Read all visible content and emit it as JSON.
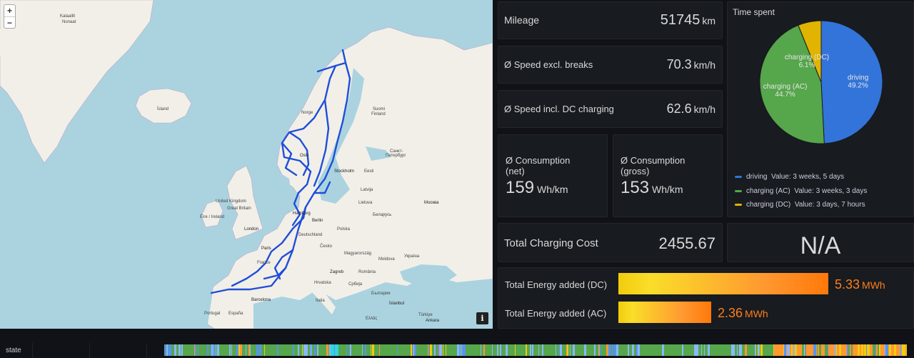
{
  "map": {
    "zoom_in": "+",
    "zoom_out": "−",
    "info": "i",
    "labels": [
      {
        "text": "Kalaallit",
        "cls": ""
      },
      {
        "text": "Nunaat",
        "cls": ""
      },
      {
        "text": "Ísland",
        "cls": ""
      },
      {
        "text": "Norge",
        "cls": ""
      },
      {
        "text": "Suomi",
        "cls": ""
      },
      {
        "text": "Finland",
        "cls": ""
      },
      {
        "text": "Санкт-",
        "cls": ""
      },
      {
        "text": "Петербург",
        "cls": ""
      },
      {
        "text": "Oslo",
        "cls": "city"
      },
      {
        "text": "Stockholm",
        "cls": "city"
      },
      {
        "text": "Eesti",
        "cls": ""
      },
      {
        "text": "Latvija",
        "cls": ""
      },
      {
        "text": "Lietuva",
        "cls": ""
      },
      {
        "text": "Москва",
        "cls": "city"
      },
      {
        "text": "Беларусь",
        "cls": ""
      },
      {
        "text": "United Kingdom",
        "cls": ""
      },
      {
        "text": "Great Britain",
        "cls": ""
      },
      {
        "text": "Éire / Ireland",
        "cls": ""
      },
      {
        "text": "London",
        "cls": "city"
      },
      {
        "text": "Hamburg",
        "cls": "city"
      },
      {
        "text": "Berlin",
        "cls": "city"
      },
      {
        "text": "Polska",
        "cls": ""
      },
      {
        "text": "Deutschland",
        "cls": ""
      },
      {
        "text": "Česko",
        "cls": ""
      },
      {
        "text": "Paris",
        "cls": "city"
      },
      {
        "text": "France",
        "cls": ""
      },
      {
        "text": "Україна",
        "cls": ""
      },
      {
        "text": "Moldova",
        "cls": ""
      },
      {
        "text": "Magyarország",
        "cls": ""
      },
      {
        "text": "Zagreb",
        "cls": "city"
      },
      {
        "text": "România",
        "cls": ""
      },
      {
        "text": "Hrvatska",
        "cls": ""
      },
      {
        "text": "Србија",
        "cls": ""
      },
      {
        "text": "България",
        "cls": ""
      },
      {
        "text": "Barcelona",
        "cls": "city"
      },
      {
        "text": "Portugal",
        "cls": ""
      },
      {
        "text": "España",
        "cls": ""
      },
      {
        "text": "Italia",
        "cls": ""
      },
      {
        "text": "Ελλάς",
        "cls": ""
      },
      {
        "text": "Türkiye",
        "cls": ""
      },
      {
        "text": "İstanbul",
        "cls": "city"
      },
      {
        "text": "Ankara",
        "cls": "city"
      }
    ]
  },
  "mileage": {
    "title": "Mileage",
    "value": "51745",
    "unit": "km"
  },
  "speed_excl": {
    "title": "Ø Speed excl. breaks",
    "value": "70.3",
    "unit": "km/h"
  },
  "speed_incl": {
    "title": "Ø Speed incl. DC charging",
    "value": "62.6",
    "unit": "km/h"
  },
  "cons_net": {
    "title_line1": "Ø Consumption",
    "title_line2": "(net)",
    "value": "159",
    "unit": "Wh/km"
  },
  "cons_gross": {
    "title_line1": "Ø Consumption",
    "title_line2": "(gross)",
    "value": "153",
    "unit": "Wh/km"
  },
  "charging_cost": {
    "title": "Total Charging Cost",
    "value": "2455.67"
  },
  "na_panel": {
    "value": "N/A"
  },
  "energy": {
    "dc": {
      "label": "Total Energy added (DC)",
      "value": "5.33",
      "unit": "MWh",
      "fraction": 1.0
    },
    "ac": {
      "label": "Total Energy added (AC)",
      "value": "2.36",
      "unit": "MWh",
      "fraction": 0.443
    }
  },
  "time_spent": {
    "title": "Time spent",
    "legend": [
      {
        "name": "driving",
        "value_text": "Value: 3 weeks, 5 days",
        "color": "#3274d9"
      },
      {
        "name": "charging (AC)",
        "value_text": "Value: 3 weeks, 3 days",
        "color": "#56a64b"
      },
      {
        "name": "charging (DC)",
        "value_text": "Value: 3 days, 7 hours",
        "color": "#e0b400"
      }
    ]
  },
  "chart_data": {
    "type": "pie",
    "title": "Time spent",
    "slices": [
      {
        "label": "driving",
        "percent": 49.2,
        "percent_text": "49.2%",
        "color": "#3274d9"
      },
      {
        "label": "charging (AC)",
        "percent": 44.7,
        "percent_text": "44.7%",
        "color": "#56a64b"
      },
      {
        "label": "charging (DC)",
        "percent": 6.1,
        "percent_text": "6.1%",
        "color": "#e0b400"
      }
    ]
  },
  "state": {
    "label": "state",
    "colors": {
      "driving": "#56a64b",
      "charging": "#8ab8ff",
      "dc": "#f2cc0c",
      "idle": "#5794f2",
      "offline": "#ff9830",
      "asleep": "#73bf69",
      "online": "#3274d9",
      "updating": "#2fd5e0"
    }
  }
}
